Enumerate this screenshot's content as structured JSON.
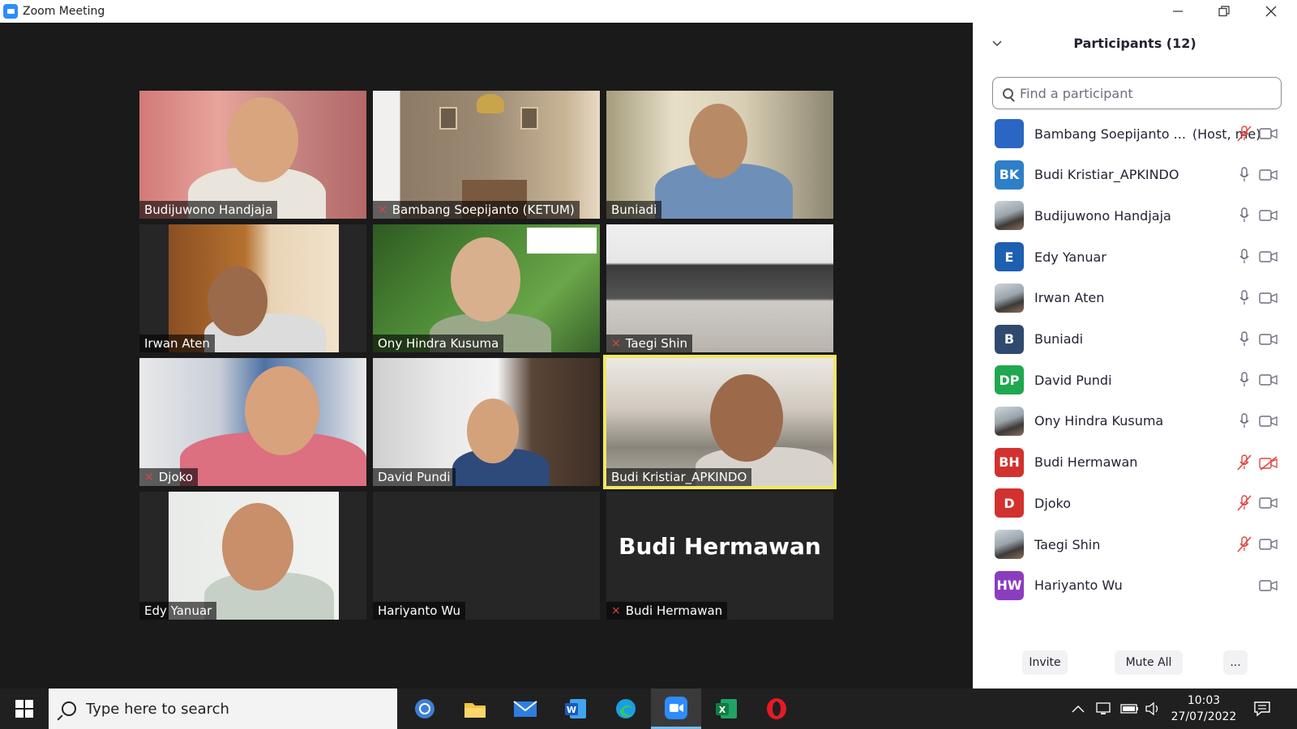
{
  "window": {
    "title": "Zoom Meeting"
  },
  "gallery": {
    "tiles": [
      {
        "name": "Budijuwono Handjaja",
        "muted": false
      },
      {
        "name": "Bambang Soepijanto (KETUM)",
        "muted": true
      },
      {
        "name": "Buniadi",
        "muted": false
      },
      {
        "name": "Irwan Aten",
        "muted": false
      },
      {
        "name": "Ony Hindra Kusuma",
        "muted": false
      },
      {
        "name": "Taegi Shin",
        "muted": true
      },
      {
        "name": "Djoko",
        "muted": true
      },
      {
        "name": "David Pundi",
        "muted": false
      },
      {
        "name": "Budi Kristiar_APKINDO",
        "muted": false,
        "active_speaker": true
      },
      {
        "name": "Edy Yanuar",
        "muted": false
      },
      {
        "name": "Hariyanto Wu",
        "muted": false
      },
      {
        "name": "Budi Hermawan",
        "muted": true,
        "display_name_large": "Budi Hermawan"
      }
    ]
  },
  "panel": {
    "title": "Participants (12)",
    "search_placeholder": "Find a participant",
    "participants": [
      {
        "name": "Bambang Soepijanto ...",
        "tag": "(Host, me)",
        "avatar": "",
        "avatar_color": "#2b66c4",
        "mic": "muted",
        "video": "on"
      },
      {
        "name": "Budi Kristiar_APKINDO",
        "tag": "",
        "avatar": "BK",
        "avatar_color": "#2e7fc7",
        "mic": "on",
        "video": "on"
      },
      {
        "name": "Budijuwono Handjaja",
        "tag": "",
        "avatar": "photo",
        "avatar_color": "",
        "mic": "on",
        "video": "on"
      },
      {
        "name": "Edy Yanuar",
        "tag": "",
        "avatar": "E",
        "avatar_color": "#1d5fb0",
        "mic": "on",
        "video": "on"
      },
      {
        "name": "Irwan Aten",
        "tag": "",
        "avatar": "photo",
        "avatar_color": "",
        "mic": "on",
        "video": "on"
      },
      {
        "name": "Buniadi",
        "tag": "",
        "avatar": "B",
        "avatar_color": "#2f4a6e",
        "mic": "on",
        "video": "on"
      },
      {
        "name": "David Pundi",
        "tag": "",
        "avatar": "DP",
        "avatar_color": "#1fa84f",
        "mic": "on",
        "video": "on"
      },
      {
        "name": "Ony Hindra Kusuma",
        "tag": "",
        "avatar": "photo",
        "avatar_color": "",
        "mic": "on",
        "video": "on"
      },
      {
        "name": "Budi Hermawan",
        "tag": "",
        "avatar": "BH",
        "avatar_color": "#d2322d",
        "mic": "muted",
        "video": "off"
      },
      {
        "name": "Djoko",
        "tag": "",
        "avatar": "D",
        "avatar_color": "#d2322d",
        "mic": "muted",
        "video": "on"
      },
      {
        "name": "Taegi Shin",
        "tag": "",
        "avatar": "photo",
        "avatar_color": "",
        "mic": "muted",
        "video": "on"
      },
      {
        "name": "Hariyanto Wu",
        "tag": "",
        "avatar": "HW",
        "avatar_color": "#8a3dbf",
        "mic": "none",
        "video": "on"
      }
    ],
    "buttons": {
      "invite": "Invite",
      "mute_all": "Mute All",
      "more": "..."
    }
  },
  "taskbar": {
    "search_placeholder": "Type here to search",
    "apps": [
      "outlook-icon",
      "file-explorer-icon",
      "mail-icon",
      "word-icon",
      "edge-icon",
      "zoom-icon",
      "excel-icon",
      "opera-icon"
    ],
    "active_app": "zoom-icon",
    "time": "10:03",
    "date": "27/07/2022"
  },
  "colors": {
    "accent": "#2d8cff",
    "mute_red": "#e0443f",
    "active_speaker": "#f3e663"
  }
}
